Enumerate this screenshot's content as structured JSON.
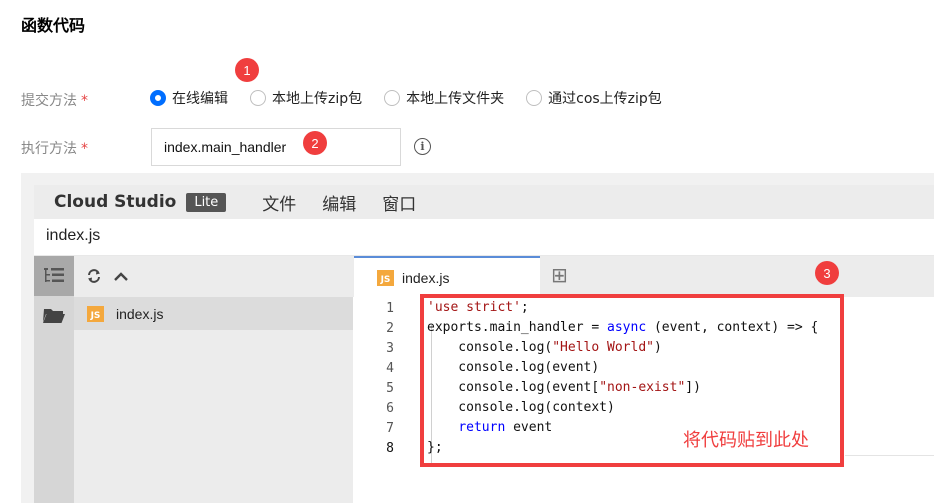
{
  "section": {
    "title": "函数代码"
  },
  "submit_method": {
    "label": "提交方法",
    "required_mark": "*",
    "options": [
      {
        "label": "在线编辑",
        "selected": true
      },
      {
        "label": "本地上传zip包",
        "selected": false
      },
      {
        "label": "本地上传文件夹",
        "selected": false
      },
      {
        "label": "通过cos上传zip包",
        "selected": false
      }
    ]
  },
  "exec_method": {
    "label": "执行方法",
    "required_mark": "*",
    "value": "index.main_handler",
    "info_icon": "i"
  },
  "badges": [
    "1",
    "2",
    "3"
  ],
  "ide": {
    "brand": "Cloud Studio",
    "brand_badge": "Lite",
    "menu": [
      "文件",
      "编辑",
      "窗口"
    ],
    "path": "index.js",
    "explorer_file": "index.js",
    "tab": "index.js",
    "js_icon_text": "JS",
    "add_tab_glyph": "⊞",
    "line_numbers": [
      "1",
      "2",
      "3",
      "4",
      "5",
      "6",
      "7",
      "8"
    ]
  },
  "annotation_note": "将代码贴到此处",
  "colors": {
    "accent": "#006eff",
    "annotation": "#f03e3e",
    "js_icon": "#f4a83d"
  }
}
